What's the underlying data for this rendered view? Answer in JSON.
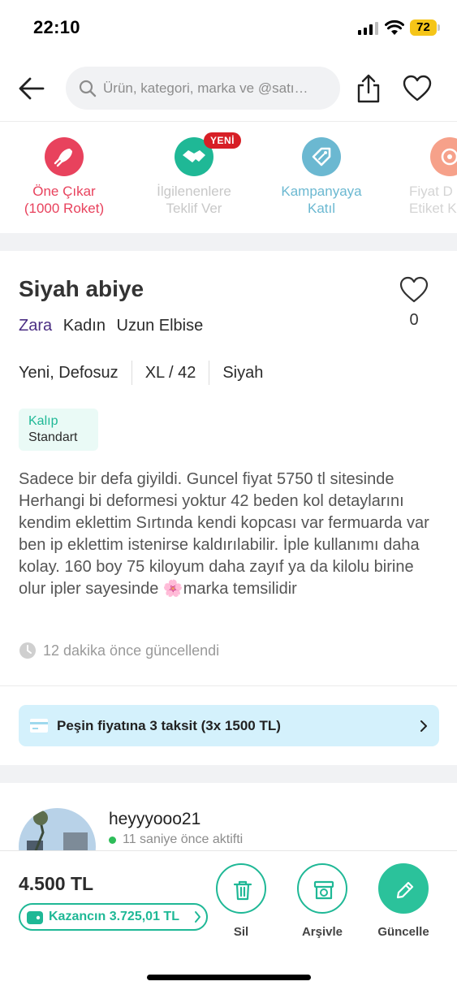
{
  "status_bar": {
    "time": "22:10",
    "battery": "72"
  },
  "header": {
    "search_placeholder": "Ürün, kategori, marka ve @satı…"
  },
  "actions": [
    {
      "label": "Öne Çıkar\n(1000 Roket)",
      "color": "#e8425d",
      "icon": "rocket-icon"
    },
    {
      "label": "İlgilenenlere\nTeklif Ver",
      "color": "#1fb896",
      "icon": "handshake-icon",
      "badge": "YENİ"
    },
    {
      "label": "Kampanyaya\nKatıl",
      "color": "#6bb8d1",
      "icon": "tag-icon"
    },
    {
      "label": "Fiyat D\nEtiket K",
      "color": "#f58a6e",
      "icon": "price-tag-icon"
    }
  ],
  "product": {
    "title": "Siyah abiye",
    "favorite_count": "0",
    "brand": "Zara",
    "gender": "Kadın",
    "category": "Uzun Elbise",
    "condition": "Yeni, Defosuz",
    "size": "XL / 42",
    "color": "Siyah",
    "fit_label": "Kalıp",
    "fit_value": "Standart",
    "description": "Sadece bir defa giyildi. Guncel fiyat 5750 tl sitesinde Herhangi bi deformesi yoktur 42 beden kol detaylarını kendim eklettim Sırtında kendi kopcası var fermuarda var ben ip eklettim istenirse kaldırılabilir. İple kullanımı daha kolay. 160 boy 75 kiloyum daha zayıf ya da kilolu birine olur ipler sayesinde 🌸marka temsilidir",
    "updated": "12 dakika önce güncellendi"
  },
  "installment": {
    "text": "Peşin fiyatına 3 taksit (3x 1500 TL)"
  },
  "seller": {
    "name": "heyyyooo21",
    "status": "11 saniye önce aktifti"
  },
  "bottom_bar": {
    "price": "4.500 TL",
    "earnings": "Kazancın 3.725,01 TL",
    "delete_label": "Sil",
    "archive_label": "Arşivle",
    "update_label": "Güncelle"
  },
  "colors": {
    "accent": "#1fb896",
    "brand": "#4b2e83",
    "installment_bg": "#d4f1fc"
  }
}
